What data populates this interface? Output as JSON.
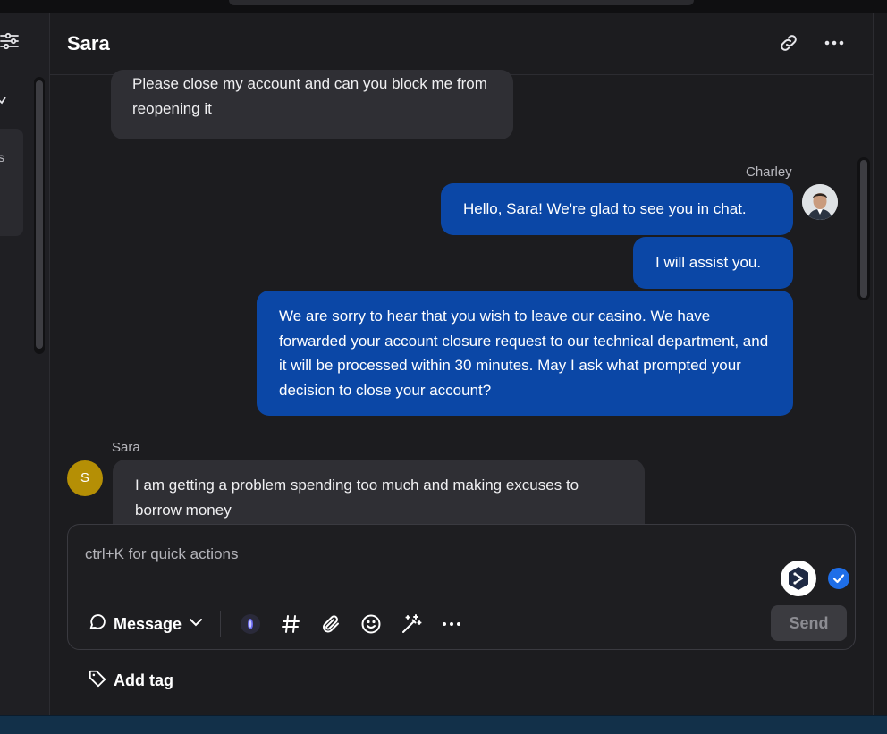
{
  "conversation": {
    "title": "Sara"
  },
  "header": {
    "link_icon": "link-icon",
    "more_icon": "more-horizontal-icon"
  },
  "sidebar": {
    "filter_icon": "sliders-icon",
    "card_letter": "s"
  },
  "messages": [
    {
      "from": "Sara",
      "direction": "in",
      "text": "Please close my account and can you block me from reopening it"
    },
    {
      "from": "Charley",
      "direction": "out",
      "text": "Hello, Sara! We're glad to see you in chat."
    },
    {
      "from": "Charley",
      "direction": "out",
      "text": "I will assist you."
    },
    {
      "from": "Charley",
      "direction": "out",
      "text": "We are sorry to hear that you wish to leave our casino. We have forwarded your account closure request to our technical department, and it will be processed within 30 minutes. May I ask what prompted your decision to close your account?"
    },
    {
      "from": "Sara",
      "direction": "in",
      "text": "I am getting a problem spending too much and making excuses to borrow money"
    }
  ],
  "senders": {
    "agent_name": "Charley",
    "customer_name": "Sara",
    "customer_initial": "S"
  },
  "composer": {
    "placeholder": "ctrl+K for quick actions",
    "mode_label": "Message",
    "send_label": "Send",
    "tools": [
      "ai-assist-icon",
      "hashtag-icon",
      "paperclip-icon",
      "emoji-icon",
      "magic-wand-icon",
      "more-horizontal-icon"
    ]
  },
  "footer": {
    "add_tag_label": "Add tag"
  },
  "colors": {
    "background": "#1c1c1f",
    "incoming_bubble": "#2f2f34",
    "outgoing_bubble": "#0b47a6",
    "customer_avatar": "#b58f05",
    "check_badge": "#1e6ee8"
  }
}
